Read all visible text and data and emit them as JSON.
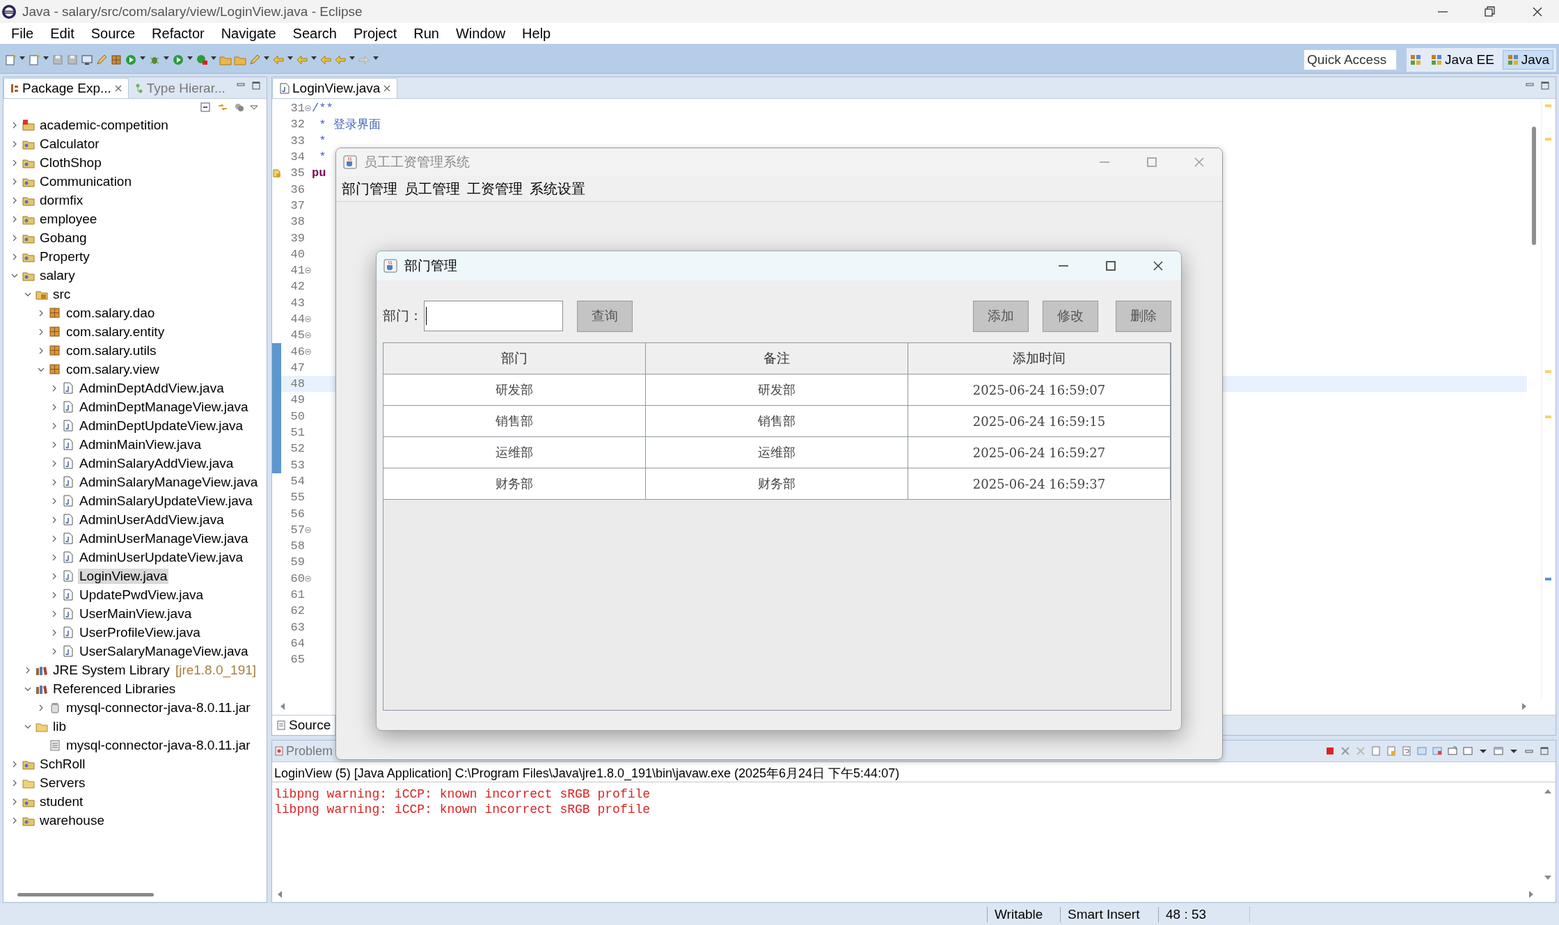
{
  "window": {
    "title": "Java - salary/src/com/salary/view/LoginView.java - Eclipse"
  },
  "menu_bar": [
    "File",
    "Edit",
    "Source",
    "Refactor",
    "Navigate",
    "Search",
    "Project",
    "Run",
    "Window",
    "Help"
  ],
  "toolbar": {
    "quick_access": {
      "placeholder": "Quick Access"
    },
    "perspectives": [
      {
        "label": "Java EE",
        "selected": false
      },
      {
        "label": "Java",
        "selected": true
      }
    ]
  },
  "package_explorer": {
    "tabs": [
      {
        "label": "Package Exp...",
        "selected": true
      },
      {
        "label": "Type Hierar...",
        "selected": false
      }
    ],
    "tree": [
      {
        "label": "academic-competition",
        "kind": "errored",
        "expanded": false,
        "selected": false
      },
      {
        "label": "Calculator",
        "kind": "project",
        "expanded": false,
        "selected": false
      },
      {
        "label": "ClothShop",
        "kind": "project",
        "expanded": false,
        "selected": false
      },
      {
        "label": "Communication",
        "kind": "project",
        "expanded": false,
        "selected": false
      },
      {
        "label": "dormfix",
        "kind": "project",
        "expanded": false,
        "selected": false
      },
      {
        "label": "employee",
        "kind": "project",
        "expanded": false,
        "selected": false
      },
      {
        "label": "Gobang",
        "kind": "project",
        "expanded": false,
        "selected": false
      },
      {
        "label": "Property",
        "kind": "project",
        "expanded": false,
        "selected": false
      },
      {
        "label": "salary",
        "kind": "project",
        "expanded": true,
        "selected": false,
        "children": [
          {
            "label": "src",
            "kind": "source",
            "expanded": true,
            "selected": false,
            "children": [
              {
                "label": "com.salary.dao",
                "kind": "package",
                "expanded": false,
                "selected": false
              },
              {
                "label": "com.salary.entity",
                "kind": "package",
                "expanded": false,
                "selected": false
              },
              {
                "label": "com.salary.utils",
                "kind": "package",
                "expanded": false,
                "selected": false
              },
              {
                "label": "com.salary.view",
                "kind": "package",
                "expanded": true,
                "selected": false,
                "children": [
                  {
                    "label": "AdminDeptAddView.java",
                    "kind": "java",
                    "expanded": false,
                    "selected": false
                  },
                  {
                    "label": "AdminDeptManageView.java",
                    "kind": "java",
                    "expanded": false,
                    "selected": false
                  },
                  {
                    "label": "AdminDeptUpdateView.java",
                    "kind": "java",
                    "expanded": false,
                    "selected": false
                  },
                  {
                    "label": "AdminMainView.java",
                    "kind": "java",
                    "expanded": false,
                    "selected": false
                  },
                  {
                    "label": "AdminSalaryAddView.java",
                    "kind": "java",
                    "expanded": false,
                    "selected": false
                  },
                  {
                    "label": "AdminSalaryManageView.java",
                    "kind": "java",
                    "expanded": false,
                    "selected": false
                  },
                  {
                    "label": "AdminSalaryUpdateView.java",
                    "kind": "java",
                    "expanded": false,
                    "selected": false
                  },
                  {
                    "label": "AdminUserAddView.java",
                    "kind": "java",
                    "expanded": false,
                    "selected": false
                  },
                  {
                    "label": "AdminUserManageView.java",
                    "kind": "java",
                    "expanded": false,
                    "selected": false
                  },
                  {
                    "label": "AdminUserUpdateView.java",
                    "kind": "java",
                    "expanded": false,
                    "selected": false
                  },
                  {
                    "label": "LoginView.java",
                    "kind": "java",
                    "expanded": false,
                    "selected": true
                  },
                  {
                    "label": "UpdatePwdView.java",
                    "kind": "java",
                    "expanded": false,
                    "selected": false
                  },
                  {
                    "label": "UserMainView.java",
                    "kind": "java",
                    "expanded": false,
                    "selected": false
                  },
                  {
                    "label": "UserProfileView.java",
                    "kind": "java",
                    "expanded": false,
                    "selected": false
                  },
                  {
                    "label": "UserSalaryManageView.java",
                    "kind": "java",
                    "expanded": false,
                    "selected": false
                  }
                ]
              }
            ]
          },
          {
            "label": "JRE System Library",
            "decoration": "[jre1.8.0_191]",
            "kind": "library",
            "expanded": false,
            "selected": false
          },
          {
            "label": "Referenced Libraries",
            "kind": "library",
            "expanded": true,
            "selected": false,
            "children": [
              {
                "label": "mysql-connector-java-8.0.11.jar",
                "kind": "jar",
                "expanded": false,
                "selected": false
              }
            ]
          },
          {
            "label": "lib",
            "kind": "folder",
            "expanded": true,
            "selected": false,
            "children": [
              {
                "label": "mysql-connector-java-8.0.11.jar",
                "kind": "file",
                "selected": false
              }
            ]
          }
        ]
      },
      {
        "label": "SchRoll",
        "kind": "project",
        "expanded": false,
        "selected": false
      },
      {
        "label": "Servers",
        "kind": "folder",
        "expanded": false,
        "selected": false
      },
      {
        "label": "student",
        "kind": "project",
        "expanded": false,
        "selected": false
      },
      {
        "label": "warehouse",
        "kind": "project",
        "expanded": false,
        "selected": false
      }
    ]
  },
  "editor": {
    "tab": {
      "label": "LoginView.java"
    },
    "lines": [
      {
        "number": "31",
        "kind": "comment",
        "text": "/**",
        "fold": true,
        "warning": false,
        "current": false,
        "in_range": false
      },
      {
        "number": "32",
        "kind": "comment",
        "text": " * 登录界面",
        "fold": false,
        "warning": false,
        "current": false,
        "in_range": false
      },
      {
        "number": "33",
        "kind": "comment",
        "text": " *",
        "fold": false,
        "warning": false,
        "current": false,
        "in_range": false
      },
      {
        "number": "34",
        "kind": "comment",
        "text": " *",
        "fold": false,
        "warning": false,
        "current": false,
        "in_range": false
      },
      {
        "number": "35",
        "kind": "keyword",
        "text": "pu",
        "fold": false,
        "warning": true,
        "current": false,
        "in_range": false
      },
      {
        "number": "36",
        "kind": "blank",
        "fold": false,
        "warning": false,
        "current": false,
        "in_range": false
      },
      {
        "number": "37",
        "kind": "blank",
        "fold": false,
        "warning": false,
        "current": false,
        "in_range": false
      },
      {
        "number": "38",
        "kind": "blank",
        "fold": false,
        "warning": false,
        "current": false,
        "in_range": false
      },
      {
        "number": "39",
        "kind": "blank",
        "fold": false,
        "warning": false,
        "current": false,
        "in_range": false
      },
      {
        "number": "40",
        "kind": "blank",
        "fold": false,
        "warning": false,
        "current": false,
        "in_range": false
      },
      {
        "number": "41",
        "kind": "blank",
        "fold": true,
        "warning": false,
        "current": false,
        "in_range": false
      },
      {
        "number": "42",
        "kind": "blank",
        "fold": false,
        "warning": false,
        "current": false,
        "in_range": false
      },
      {
        "number": "43",
        "kind": "blank",
        "fold": false,
        "warning": false,
        "current": false,
        "in_range": false
      },
      {
        "number": "44",
        "kind": "blank",
        "fold": true,
        "warning": false,
        "current": false,
        "in_range": false
      },
      {
        "number": "45",
        "kind": "blank",
        "fold": true,
        "warning": false,
        "current": false,
        "in_range": false
      },
      {
        "number": "46",
        "kind": "blank",
        "fold": true,
        "warning": false,
        "current": false,
        "in_range": true
      },
      {
        "number": "47",
        "kind": "blank",
        "fold": false,
        "warning": false,
        "current": false,
        "in_range": true
      },
      {
        "number": "48",
        "kind": "blank",
        "fold": false,
        "warning": false,
        "current": true,
        "in_range": true
      },
      {
        "number": "49",
        "kind": "blank",
        "fold": false,
        "warning": false,
        "current": false,
        "in_range": true
      },
      {
        "number": "50",
        "kind": "blank",
        "fold": false,
        "warning": false,
        "current": false,
        "in_range": true
      },
      {
        "number": "51",
        "kind": "blank",
        "fold": false,
        "warning": false,
        "current": false,
        "in_range": true
      },
      {
        "number": "52",
        "kind": "blank",
        "fold": false,
        "warning": false,
        "current": false,
        "in_range": true
      },
      {
        "number": "53",
        "kind": "blank",
        "fold": false,
        "warning": false,
        "current": false,
        "in_range": true
      },
      {
        "number": "54",
        "kind": "blank",
        "fold": false,
        "warning": false,
        "current": false,
        "in_range": false
      },
      {
        "number": "55",
        "kind": "blank",
        "fold": false,
        "warning": false,
        "current": false,
        "in_range": false
      },
      {
        "number": "56",
        "kind": "blank",
        "fold": false,
        "warning": false,
        "current": false,
        "in_range": false
      },
      {
        "number": "57",
        "kind": "blank",
        "fold": true,
        "warning": false,
        "current": false,
        "in_range": false
      },
      {
        "number": "58",
        "kind": "blank",
        "fold": false,
        "warning": false,
        "current": false,
        "in_range": false
      },
      {
        "number": "59",
        "kind": "blank",
        "fold": false,
        "warning": false,
        "current": false,
        "in_range": false
      },
      {
        "number": "60",
        "kind": "blank",
        "fold": true,
        "warning": false,
        "current": false,
        "in_range": false
      },
      {
        "number": "61",
        "kind": "blank",
        "fold": false,
        "warning": false,
        "current": false,
        "in_range": false
      },
      {
        "number": "62",
        "kind": "blank",
        "fold": false,
        "warning": false,
        "current": false,
        "in_range": false
      },
      {
        "number": "63",
        "kind": "blank",
        "fold": false,
        "warning": false,
        "current": false,
        "in_range": false
      },
      {
        "number": "64",
        "kind": "blank",
        "fold": false,
        "warning": false,
        "current": false,
        "in_range": false
      },
      {
        "number": "65",
        "kind": "blank",
        "fold": false,
        "warning": false,
        "current": false,
        "in_range": false
      }
    ],
    "bottom_tabs": [
      {
        "label": "Source",
        "selected": true
      }
    ]
  },
  "console": {
    "tab": {
      "label": "Problem"
    },
    "header": "LoginView (5) [Java Application] C:\\Program Files\\Java\\jre1.8.0_191\\bin\\javaw.exe (2025年6月24日 下午5:44:07)",
    "output": [
      "libpng warning: iCCP: known incorrect sRGB profile",
      "libpng warning: iCCP: known incorrect sRGB profile"
    ]
  },
  "status_bar": [
    "Writable",
    "Smart Insert",
    "48 : 53"
  ],
  "app_window": {
    "title": "员工工资管理系统",
    "active": false,
    "menu": [
      "部门管理",
      "员工管理",
      "工资管理",
      "系统设置"
    ],
    "dialog": {
      "title": "部门管理",
      "search_label": "部门：",
      "search_button": "查询",
      "actions": [
        "添加",
        "修改",
        "删除"
      ],
      "table": {
        "columns": [
          "部门",
          "备注",
          "添加时间"
        ],
        "rows": [
          [
            "研发部",
            "研发部",
            "2025-06-24 16:59:07"
          ],
          [
            "销售部",
            "销售部",
            "2025-06-24 16:59:15"
          ],
          [
            "运维部",
            "运维部",
            "2025-06-24 16:59:27"
          ],
          [
            "财务部",
            "财务部",
            "2025-06-24 16:59:37"
          ]
        ]
      }
    }
  }
}
